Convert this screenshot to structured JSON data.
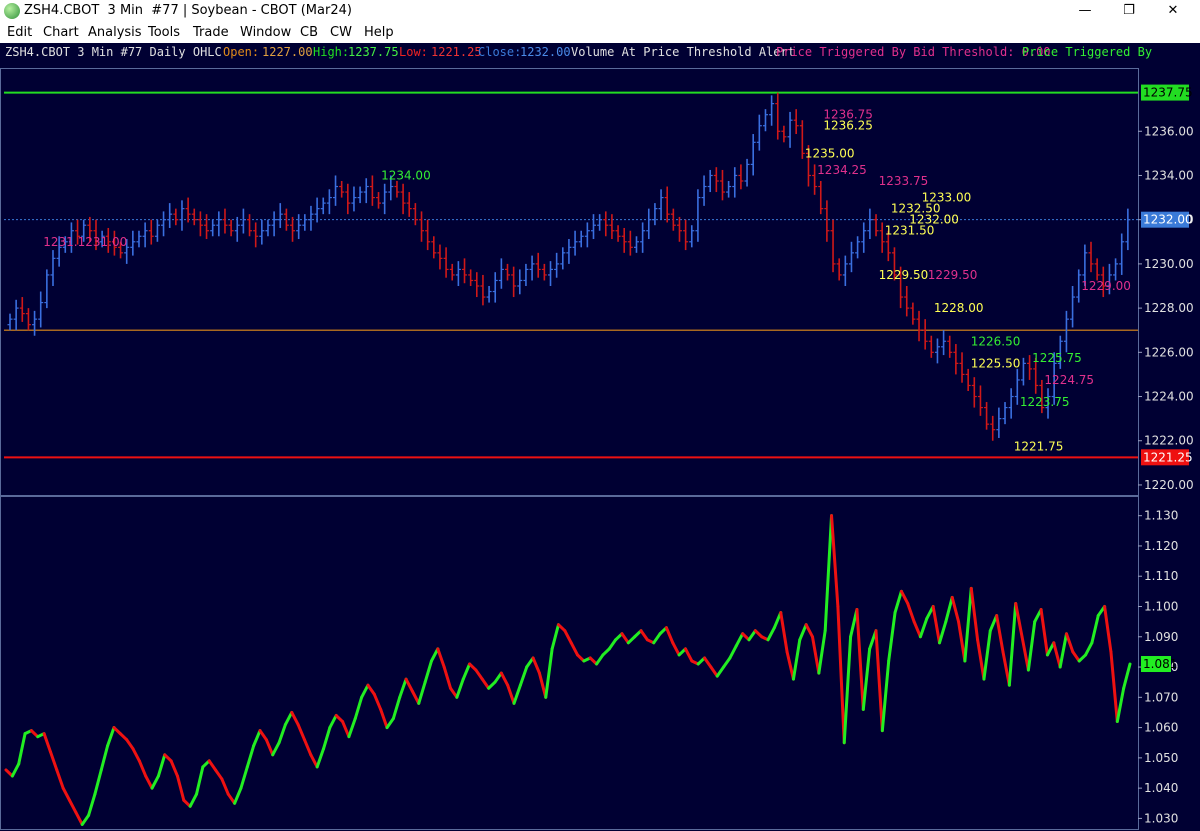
{
  "window": {
    "title": "ZSH4.CBOT  3 Min  #77 | Soybean - CBOT (Mar24)",
    "minimize_glyph": "—",
    "restore_glyph": "❐",
    "close_glyph": "✕"
  },
  "menu": [
    "Edit",
    "Chart",
    "Analysis",
    "Tools",
    "Trade",
    "Window",
    "CB",
    "CW",
    "Help"
  ],
  "header": {
    "symbol": "ZSH4.CBOT 3 Min  #77 Daily OHLC",
    "open_label": "Open:",
    "open_value": "1227.00",
    "high_label": "High:",
    "high_value": "1237.75",
    "low_label": "Low:",
    "low_value": "1221.25",
    "close_label": "Close:",
    "close_value": "1232.00",
    "alert_text": "Volume At Price Threshold Alert",
    "bid_text": "Price Triggered By Bid Threshold: 0.00",
    "ask_text": "Price Triggered By"
  },
  "colors": {
    "background": "#000033",
    "bull": "#3a6fe0",
    "bear": "#d01818",
    "high_line": "#22dd22",
    "low_line": "#ee1111",
    "open_line": "#e08a1a",
    "close_line": "#3a7ad8",
    "axis_text": "#e0e0e0",
    "label_yellow": "#ffff55",
    "label_magenta": "#e0308c",
    "label_green": "#33ee33"
  },
  "chart_data": [
    {
      "type": "ohlc",
      "ylim": [
        1219.5,
        1238.5
      ],
      "y_ticks": [
        "1236.00",
        "1234.00",
        "1232.00",
        "1230.00",
        "1228.00",
        "1226.00",
        "1224.00",
        "1222.00",
        "1220.00"
      ],
      "y_tick_values": [
        1236,
        1234,
        1232,
        1230,
        1228,
        1226,
        1224,
        1222,
        1220
      ],
      "reference_lines": [
        {
          "name": "high",
          "value": 1237.75,
          "label": "1237.75",
          "color": "#22dd22"
        },
        {
          "name": "open",
          "value": 1227.0,
          "label": "",
          "color": "#e08a1a"
        },
        {
          "name": "low",
          "value": 1221.25,
          "label": "1221.25",
          "color": "#ee1111"
        },
        {
          "name": "close",
          "value": 1232.0,
          "label": "1232.00",
          "color": "#3a7ad8"
        }
      ],
      "close_series": [
        1227.5,
        1228.0,
        1227.75,
        1227.25,
        1227.5,
        1228.25,
        1229.5,
        1230.25,
        1230.75,
        1231.0,
        1231.5,
        1231.25,
        1231.75,
        1231.5,
        1231.0,
        1231.25,
        1231.0,
        1230.75,
        1230.5,
        1230.75,
        1231.0,
        1231.25,
        1231.5,
        1231.25,
        1231.75,
        1232.0,
        1232.25,
        1232.0,
        1232.5,
        1232.25,
        1232.0,
        1231.75,
        1231.5,
        1231.75,
        1232.0,
        1231.75,
        1231.5,
        1231.75,
        1232.0,
        1231.5,
        1231.25,
        1231.5,
        1231.75,
        1232.0,
        1232.25,
        1231.75,
        1231.5,
        1231.75,
        1232.0,
        1232.25,
        1232.5,
        1232.75,
        1233.0,
        1233.5,
        1233.25,
        1232.75,
        1233.0,
        1233.25,
        1233.5,
        1233.0,
        1232.75,
        1233.25,
        1233.5,
        1233.25,
        1232.75,
        1232.5,
        1232.0,
        1231.5,
        1231.0,
        1230.5,
        1230.25,
        1229.75,
        1229.5,
        1229.75,
        1229.5,
        1229.25,
        1229.0,
        1228.5,
        1228.75,
        1229.25,
        1229.75,
        1229.5,
        1229.0,
        1229.25,
        1229.75,
        1230.0,
        1229.75,
        1229.5,
        1229.75,
        1230.0,
        1230.5,
        1230.75,
        1231.0,
        1231.25,
        1231.5,
        1231.75,
        1232.0,
        1231.75,
        1231.5,
        1231.25,
        1231.0,
        1230.75,
        1231.0,
        1231.5,
        1232.0,
        1232.5,
        1233.0,
        1232.25,
        1231.75,
        1231.5,
        1231.0,
        1231.5,
        1233.0,
        1233.5,
        1234.0,
        1233.75,
        1233.25,
        1233.5,
        1234.0,
        1233.75,
        1234.5,
        1235.5,
        1236.25,
        1236.75,
        1237.25,
        1236.0,
        1235.75,
        1236.5,
        1236.25,
        1235.0,
        1234.0,
        1233.5,
        1232.5,
        1231.5,
        1230.0,
        1229.5,
        1230.0,
        1230.5,
        1231.0,
        1231.5,
        1232.0,
        1231.5,
        1231.0,
        1230.5,
        1229.5,
        1228.5,
        1228.0,
        1227.5,
        1227.0,
        1226.5,
        1226.0,
        1226.25,
        1226.5,
        1226.0,
        1225.5,
        1225.0,
        1224.5,
        1224.0,
        1223.5,
        1222.75,
        1222.5,
        1223.0,
        1223.5,
        1224.0,
        1224.75,
        1225.5,
        1225.25,
        1224.5,
        1223.5,
        1224.0,
        1225.5,
        1226.5,
        1227.5,
        1228.5,
        1229.5,
        1230.5,
        1230.0,
        1229.5,
        1229.0,
        1229.5,
        1230.0,
        1231.0,
        1232.0
      ],
      "price_labels": [
        {
          "text": "1231.1231.00",
          "x": 1231.0,
          "idx": 9,
          "color": "magenta"
        },
        {
          "text": "1234.00",
          "x": 1234.0,
          "idx": 64,
          "color": "green"
        },
        {
          "text": "1236.75",
          "x": 1236.75,
          "idx": 136,
          "color": "magenta"
        },
        {
          "text": "1236.25",
          "x": 1236.25,
          "idx": 136,
          "color": "yellow"
        },
        {
          "text": "1235.00",
          "x": 1235.0,
          "idx": 133,
          "color": "yellow"
        },
        {
          "text": "1234.25",
          "x": 1234.25,
          "idx": 135,
          "color": "magenta"
        },
        {
          "text": "1233.75",
          "x": 1233.75,
          "idx": 145,
          "color": "magenta"
        },
        {
          "text": "1233.00",
          "x": 1233.0,
          "idx": 152,
          "color": "yellow"
        },
        {
          "text": "1232.50",
          "x": 1232.5,
          "idx": 147,
          "color": "yellow"
        },
        {
          "text": "1232.00",
          "x": 1232.0,
          "idx": 150,
          "color": "yellow"
        },
        {
          "text": "1231.50",
          "x": 1231.5,
          "idx": 146,
          "color": "yellow"
        },
        {
          "text": "1229.50",
          "x": 1229.5,
          "idx": 145,
          "color": "yellow"
        },
        {
          "text": "1229.50",
          "x": 1229.5,
          "idx": 153,
          "color": "magenta"
        },
        {
          "text": "1228.00",
          "x": 1228.0,
          "idx": 154,
          "color": "yellow"
        },
        {
          "text": "1226.50",
          "x": 1226.5,
          "idx": 160,
          "color": "green"
        },
        {
          "text": "1225.50",
          "x": 1225.5,
          "idx": 160,
          "color": "yellow"
        },
        {
          "text": "1225.75",
          "x": 1225.75,
          "idx": 170,
          "color": "green"
        },
        {
          "text": "1224.75",
          "x": 1224.75,
          "idx": 172,
          "color": "magenta"
        },
        {
          "text": "1223.75",
          "x": 1223.75,
          "idx": 168,
          "color": "green"
        },
        {
          "text": "1221.75",
          "x": 1221.75,
          "idx": 167,
          "color": "yellow"
        },
        {
          "text": "1229.00",
          "x": 1229.0,
          "idx": 178,
          "color": "magenta"
        }
      ]
    },
    {
      "type": "line",
      "ylim": [
        1.0265,
        1.1365
      ],
      "y_ticks": [
        "1.130",
        "1.120",
        "1.110",
        "1.100",
        "1.090",
        "1.080",
        "1.070",
        "1.060",
        "1.050",
        "1.040",
        "1.030"
      ],
      "y_tick_values": [
        1.13,
        1.12,
        1.11,
        1.1,
        1.09,
        1.08,
        1.07,
        1.06,
        1.05,
        1.04,
        1.03
      ],
      "last_value_label": "1.081",
      "values": [
        1.046,
        1.044,
        1.048,
        1.058,
        1.059,
        1.057,
        1.058,
        1.052,
        1.046,
        1.04,
        1.036,
        1.032,
        1.028,
        1.031,
        1.038,
        1.046,
        1.054,
        1.06,
        1.058,
        1.056,
        1.053,
        1.049,
        1.044,
        1.04,
        1.044,
        1.051,
        1.049,
        1.044,
        1.036,
        1.034,
        1.038,
        1.047,
        1.049,
        1.046,
        1.043,
        1.038,
        1.035,
        1.04,
        1.047,
        1.054,
        1.059,
        1.056,
        1.051,
        1.055,
        1.061,
        1.065,
        1.061,
        1.056,
        1.051,
        1.047,
        1.053,
        1.06,
        1.064,
        1.062,
        1.057,
        1.063,
        1.07,
        1.074,
        1.071,
        1.066,
        1.06,
        1.063,
        1.07,
        1.076,
        1.072,
        1.068,
        1.075,
        1.082,
        1.086,
        1.08,
        1.073,
        1.07,
        1.076,
        1.081,
        1.079,
        1.076,
        1.073,
        1.075,
        1.078,
        1.074,
        1.068,
        1.074,
        1.08,
        1.083,
        1.078,
        1.07,
        1.086,
        1.094,
        1.092,
        1.088,
        1.084,
        1.082,
        1.083,
        1.081,
        1.084,
        1.086,
        1.089,
        1.091,
        1.088,
        1.09,
        1.092,
        1.089,
        1.088,
        1.091,
        1.093,
        1.088,
        1.084,
        1.086,
        1.082,
        1.081,
        1.083,
        1.08,
        1.077,
        1.08,
        1.083,
        1.087,
        1.091,
        1.089,
        1.092,
        1.09,
        1.089,
        1.093,
        1.098,
        1.085,
        1.076,
        1.089,
        1.094,
        1.09,
        1.078,
        1.092,
        1.13,
        1.1,
        1.055,
        1.09,
        1.099,
        1.066,
        1.086,
        1.092,
        1.059,
        1.082,
        1.098,
        1.105,
        1.101,
        1.095,
        1.09,
        1.096,
        1.1,
        1.088,
        1.095,
        1.103,
        1.095,
        1.082,
        1.106,
        1.089,
        1.076,
        1.092,
        1.097,
        1.085,
        1.074,
        1.101,
        1.09,
        1.079,
        1.095,
        1.099,
        1.084,
        1.088,
        1.08,
        1.091,
        1.085,
        1.082,
        1.084,
        1.088,
        1.097,
        1.1,
        1.085,
        1.062,
        1.073,
        1.081
      ],
      "color_up": "#22ee22",
      "color_down": "#ee1111"
    }
  ]
}
